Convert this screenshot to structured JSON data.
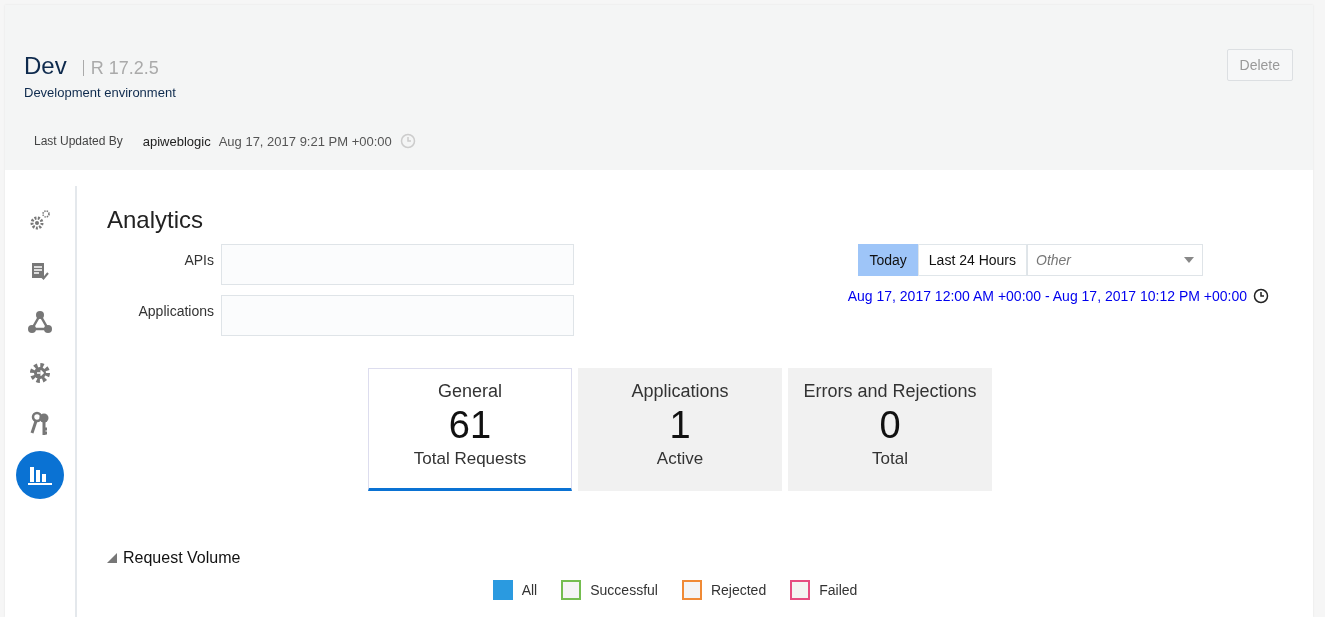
{
  "header": {
    "title": "Dev",
    "release": "R 17.2.5",
    "subtitle": "Development environment",
    "delete_button": {
      "label": "Delete",
      "disabled": true
    },
    "updated_label": "Last Updated By",
    "updated_by": "apiweblogic",
    "updated_at": "Aug 17, 2017 9:21 PM +00:00"
  },
  "sidebar": {
    "items": [
      {
        "selected": false
      },
      {
        "selected": false
      },
      {
        "selected": false
      },
      {
        "selected": false
      },
      {
        "selected": false
      },
      {
        "selected": true
      }
    ]
  },
  "analytics": {
    "title": "Analytics",
    "filters": [
      {
        "label": "APIs"
      },
      {
        "label": "Applications"
      }
    ],
    "time_buttons": [
      {
        "label": "Today",
        "selected": true
      },
      {
        "label": "Last 24 Hours",
        "selected": false
      }
    ],
    "time_select": {
      "placeholder": "Other"
    },
    "date_range": "Aug 17, 2017 12:00 AM +00:00 - Aug 17, 2017 10:12 PM +00:00",
    "tiles": [
      {
        "title": "General",
        "value": "61",
        "caption": "Total Requests",
        "selected": true
      },
      {
        "title": "Applications",
        "value": "1",
        "caption": "Active",
        "selected": false
      },
      {
        "title": "Errors and Rejections",
        "value": "0",
        "caption": "Total",
        "selected": false
      }
    ],
    "section": {
      "title": "Request Volume",
      "expanded": true
    },
    "legend": [
      {
        "label": "All",
        "color": "#2a9ae0",
        "selected": true
      },
      {
        "label": "Successful",
        "color": "#74bd4f",
        "selected": false
      },
      {
        "label": "Rejected",
        "color": "#f08a35",
        "selected": false
      },
      {
        "label": "Failed",
        "color": "#e64d82",
        "selected": false
      }
    ]
  }
}
